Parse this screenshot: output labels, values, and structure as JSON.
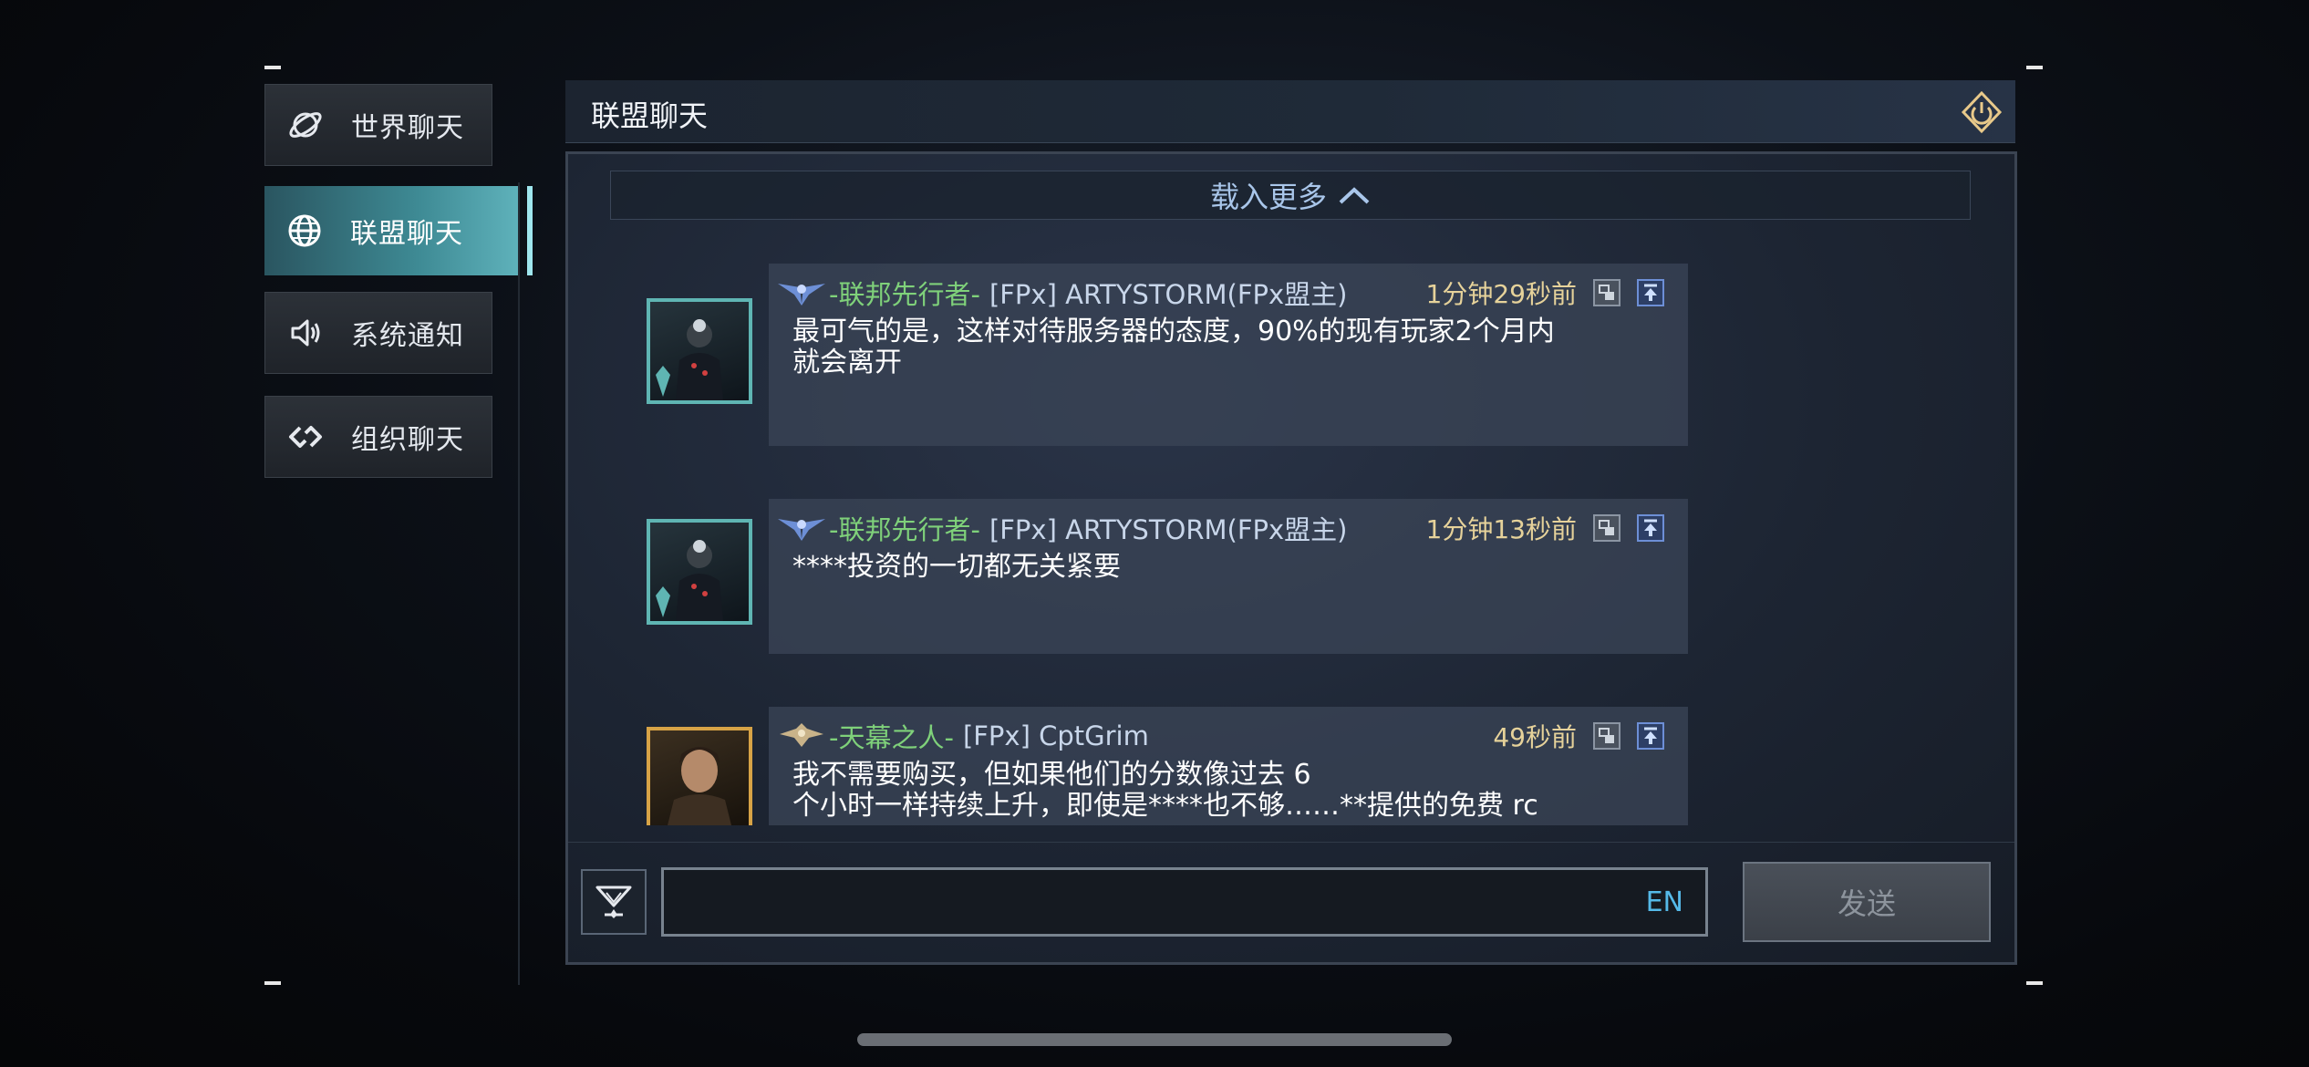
{
  "sidebar": {
    "items": [
      {
        "label": "世界聊天",
        "icon": "planet-icon",
        "active": false
      },
      {
        "label": "联盟聊天",
        "icon": "globe-icon",
        "active": true
      },
      {
        "label": "系统通知",
        "icon": "speaker-icon",
        "active": false
      },
      {
        "label": "组织聊天",
        "icon": "link-icon",
        "active": false
      }
    ]
  },
  "header": {
    "title": "联盟聊天",
    "exit_icon": "power-icon"
  },
  "load_more": {
    "label": "载入更多",
    "icon": "chevron-up-icon"
  },
  "messages": [
    {
      "title": "-联邦先行者-",
      "name": "[FPx] ARTYSTORM(FPx盟主)",
      "time": "1分钟29秒前",
      "text": "最可气的是，这样对待服务器的态度，90%的现有玩家2个月内\n就会离开",
      "avatar_frame": "teal"
    },
    {
      "title": "-联邦先行者-",
      "name": "[FPx] ARTYSTORM(FPx盟主)",
      "time": "1分钟13秒前",
      "text": "****投资的一切都无关紧要",
      "avatar_frame": "teal"
    },
    {
      "title": "-天幕之人-",
      "name": "[FPx] CptGrim",
      "time": "49秒前",
      "text": "我不需要购买，但如果他们的分数像过去 6\n个小时一样持续上升，即使是****也不够……**提供的免费 rc",
      "avatar_frame": "gold"
    }
  ],
  "input": {
    "value": "",
    "lang": "EN",
    "filter_icon": "filter-icon"
  },
  "send_button": {
    "label": "发送"
  },
  "colors": {
    "accent": "#5fb2bb",
    "title_green": "#7fd17a",
    "time_gold": "#e6d29a",
    "lang_blue": "#55b9e8"
  }
}
